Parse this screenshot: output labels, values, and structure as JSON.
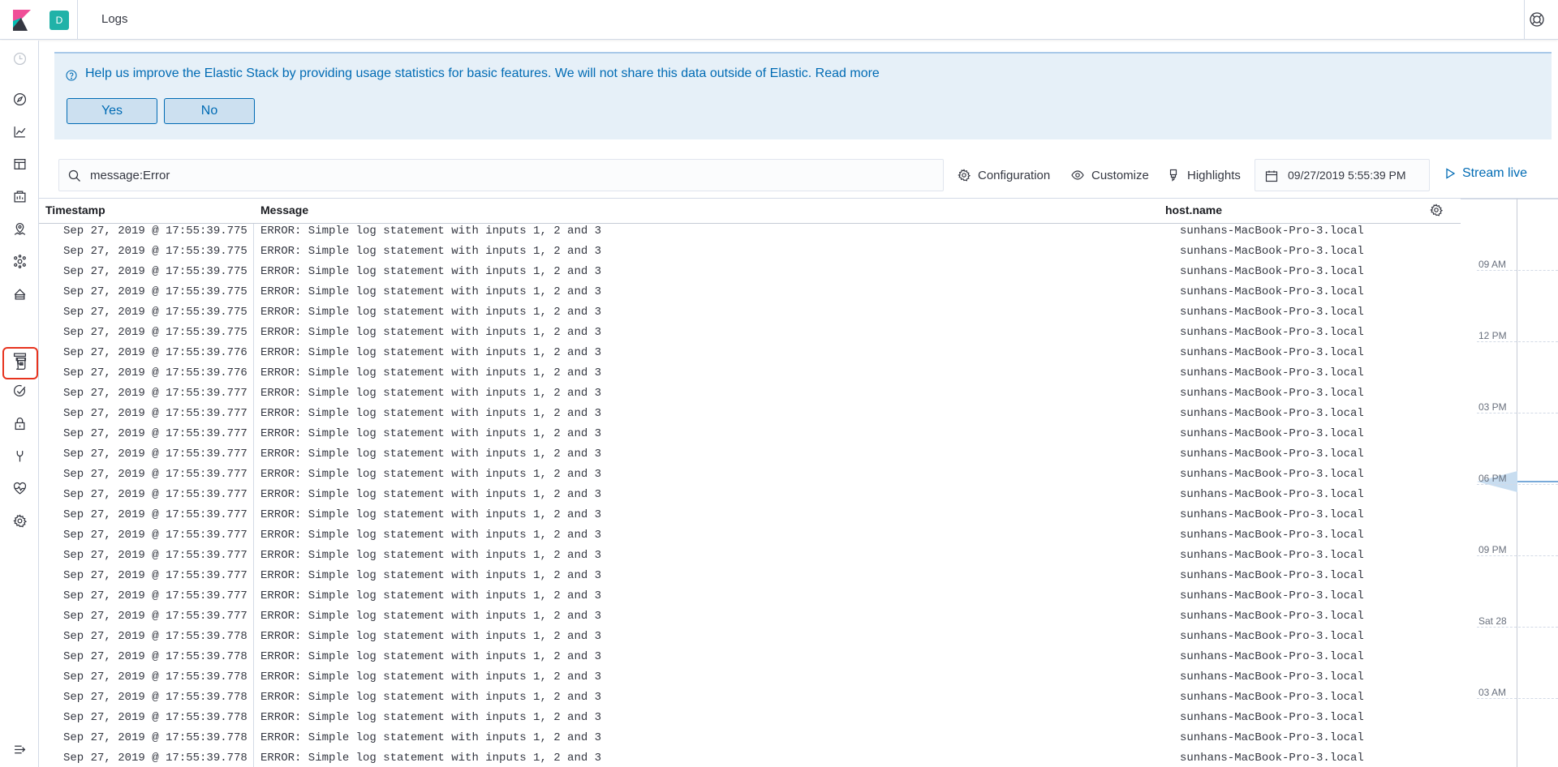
{
  "header": {
    "space_initial": "D",
    "breadcrumb": "Logs"
  },
  "callout": {
    "text": "Help us improve the Elastic Stack by providing usage statistics for basic features. We will not share this data outside of Elastic. Read more",
    "yes_label": "Yes",
    "no_label": "No"
  },
  "toolbar": {
    "query": "message:Error",
    "configuration_label": "Configuration",
    "customize_label": "Customize",
    "highlights_label": "Highlights",
    "date": "09/27/2019 5:55:39 PM",
    "stream_label": "Stream live"
  },
  "table": {
    "columns": [
      "Timestamp",
      "Message",
      "host.name"
    ],
    "rows": [
      {
        "ts": "Sep 27, 2019 @ 17:55:39.775",
        "msg": "ERROR: Simple log statement with inputs 1, 2 and 3",
        "host": "sunhans-MacBook-Pro-3.local"
      },
      {
        "ts": "Sep 27, 2019 @ 17:55:39.775",
        "msg": "ERROR: Simple log statement with inputs 1, 2 and 3",
        "host": "sunhans-MacBook-Pro-3.local"
      },
      {
        "ts": "Sep 27, 2019 @ 17:55:39.775",
        "msg": "ERROR: Simple log statement with inputs 1, 2 and 3",
        "host": "sunhans-MacBook-Pro-3.local"
      },
      {
        "ts": "Sep 27, 2019 @ 17:55:39.775",
        "msg": "ERROR: Simple log statement with inputs 1, 2 and 3",
        "host": "sunhans-MacBook-Pro-3.local"
      },
      {
        "ts": "Sep 27, 2019 @ 17:55:39.775",
        "msg": "ERROR: Simple log statement with inputs 1, 2 and 3",
        "host": "sunhans-MacBook-Pro-3.local"
      },
      {
        "ts": "Sep 27, 2019 @ 17:55:39.775",
        "msg": "ERROR: Simple log statement with inputs 1, 2 and 3",
        "host": "sunhans-MacBook-Pro-3.local"
      },
      {
        "ts": "Sep 27, 2019 @ 17:55:39.776",
        "msg": "ERROR: Simple log statement with inputs 1, 2 and 3",
        "host": "sunhans-MacBook-Pro-3.local"
      },
      {
        "ts": "Sep 27, 2019 @ 17:55:39.776",
        "msg": "ERROR: Simple log statement with inputs 1, 2 and 3",
        "host": "sunhans-MacBook-Pro-3.local"
      },
      {
        "ts": "Sep 27, 2019 @ 17:55:39.777",
        "msg": "ERROR: Simple log statement with inputs 1, 2 and 3",
        "host": "sunhans-MacBook-Pro-3.local"
      },
      {
        "ts": "Sep 27, 2019 @ 17:55:39.777",
        "msg": "ERROR: Simple log statement with inputs 1, 2 and 3",
        "host": "sunhans-MacBook-Pro-3.local"
      },
      {
        "ts": "Sep 27, 2019 @ 17:55:39.777",
        "msg": "ERROR: Simple log statement with inputs 1, 2 and 3",
        "host": "sunhans-MacBook-Pro-3.local"
      },
      {
        "ts": "Sep 27, 2019 @ 17:55:39.777",
        "msg": "ERROR: Simple log statement with inputs 1, 2 and 3",
        "host": "sunhans-MacBook-Pro-3.local"
      },
      {
        "ts": "Sep 27, 2019 @ 17:55:39.777",
        "msg": "ERROR: Simple log statement with inputs 1, 2 and 3",
        "host": "sunhans-MacBook-Pro-3.local"
      },
      {
        "ts": "Sep 27, 2019 @ 17:55:39.777",
        "msg": "ERROR: Simple log statement with inputs 1, 2 and 3",
        "host": "sunhans-MacBook-Pro-3.local"
      },
      {
        "ts": "Sep 27, 2019 @ 17:55:39.777",
        "msg": "ERROR: Simple log statement with inputs 1, 2 and 3",
        "host": "sunhans-MacBook-Pro-3.local"
      },
      {
        "ts": "Sep 27, 2019 @ 17:55:39.777",
        "msg": "ERROR: Simple log statement with inputs 1, 2 and 3",
        "host": "sunhans-MacBook-Pro-3.local"
      },
      {
        "ts": "Sep 27, 2019 @ 17:55:39.777",
        "msg": "ERROR: Simple log statement with inputs 1, 2 and 3",
        "host": "sunhans-MacBook-Pro-3.local"
      },
      {
        "ts": "Sep 27, 2019 @ 17:55:39.777",
        "msg": "ERROR: Simple log statement with inputs 1, 2 and 3",
        "host": "sunhans-MacBook-Pro-3.local"
      },
      {
        "ts": "Sep 27, 2019 @ 17:55:39.777",
        "msg": "ERROR: Simple log statement with inputs 1, 2 and 3",
        "host": "sunhans-MacBook-Pro-3.local"
      },
      {
        "ts": "Sep 27, 2019 @ 17:55:39.777",
        "msg": "ERROR: Simple log statement with inputs 1, 2 and 3",
        "host": "sunhans-MacBook-Pro-3.local"
      },
      {
        "ts": "Sep 27, 2019 @ 17:55:39.778",
        "msg": "ERROR: Simple log statement with inputs 1, 2 and 3",
        "host": "sunhans-MacBook-Pro-3.local"
      },
      {
        "ts": "Sep 27, 2019 @ 17:55:39.778",
        "msg": "ERROR: Simple log statement with inputs 1, 2 and 3",
        "host": "sunhans-MacBook-Pro-3.local"
      },
      {
        "ts": "Sep 27, 2019 @ 17:55:39.778",
        "msg": "ERROR: Simple log statement with inputs 1, 2 and 3",
        "host": "sunhans-MacBook-Pro-3.local"
      },
      {
        "ts": "Sep 27, 2019 @ 17:55:39.778",
        "msg": "ERROR: Simple log statement with inputs 1, 2 and 3",
        "host": "sunhans-MacBook-Pro-3.local"
      },
      {
        "ts": "Sep 27, 2019 @ 17:55:39.778",
        "msg": "ERROR: Simple log statement with inputs 1, 2 and 3",
        "host": "sunhans-MacBook-Pro-3.local"
      },
      {
        "ts": "Sep 27, 2019 @ 17:55:39.778",
        "msg": "ERROR: Simple log statement with inputs 1, 2 and 3",
        "host": "sunhans-MacBook-Pro-3.local"
      },
      {
        "ts": "Sep 27, 2019 @ 17:55:39.778",
        "msg": "ERROR: Simple log statement with inputs 1, 2 and 3",
        "host": "sunhans-MacBook-Pro-3.local"
      }
    ]
  },
  "minimap": {
    "ticks": [
      "09 AM",
      "12 PM",
      "03 PM",
      "06 PM",
      "09 PM",
      "Sat 28",
      "03 AM"
    ]
  },
  "colors": {
    "accent": "#006bb4",
    "space_badge": "#20b2a8",
    "active_highlight": "#e7331e"
  }
}
